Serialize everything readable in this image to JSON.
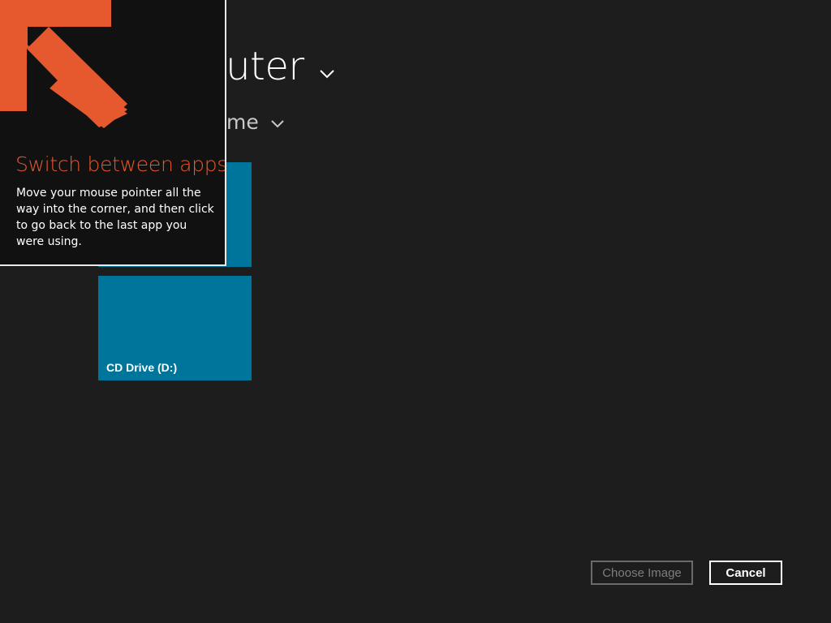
{
  "header": {
    "location_title": "Computer",
    "sort_label": "Sort by name"
  },
  "tiles": [
    {
      "label": ""
    },
    {
      "label": "CD Drive (D:)"
    }
  ],
  "tip": {
    "title": "Switch between apps",
    "body": "Move your mouse pointer all the way into the corner, and then click to go back to the last app you were using.",
    "title_color": "#e6582e",
    "arrow_color": "#e6582e",
    "arrow_icon": "arrow-up-left-icon"
  },
  "buttons": {
    "choose_image": "Choose Image",
    "cancel": "Cancel"
  },
  "colors": {
    "background": "#1d1d1d",
    "tile": "#00759b"
  }
}
